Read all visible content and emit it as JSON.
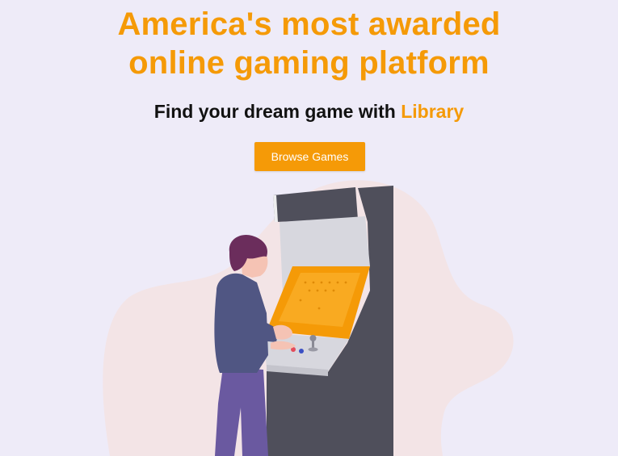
{
  "hero": {
    "headline": "America's most awarded online gaming platform",
    "subhead_prefix": "Find your dream game with ",
    "subhead_accent": "Library",
    "cta_label": "Browse Games"
  },
  "colors": {
    "background": "#eeebf8",
    "accent": "#f59a07",
    "blob": "#f3e4e6",
    "cabinet_dark": "#4f4f5b",
    "cabinet_light": "#d7d7de",
    "shirt": "#505683",
    "pants": "#6a59a0",
    "hair": "#6b2d5c",
    "skin": "#f5c3b4"
  },
  "illustration": {
    "name": "person-playing-arcade-machine"
  }
}
